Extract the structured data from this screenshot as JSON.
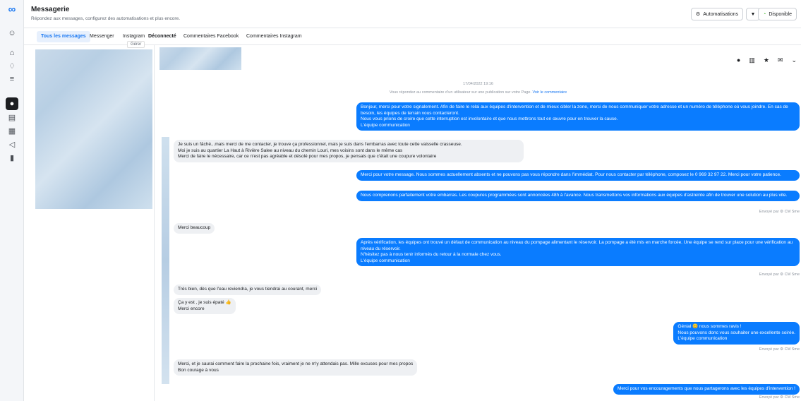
{
  "header": {
    "title": "Messagerie",
    "subtitle": "Répondez aux messages, configurez des automatisations et plus encore.",
    "automations_label": "Automatisations",
    "status_label": "Disponible"
  },
  "tabs": [
    {
      "label": "Tous les messages"
    },
    {
      "label": "Messenger"
    },
    {
      "label": "Instagram"
    },
    {
      "label": "Déconnecté"
    },
    {
      "label": "Commentaires Facebook"
    },
    {
      "label": "Commentaires Instagram"
    }
  ],
  "tooltip": "Gérer",
  "chat": {
    "timestamp": "17/04/2022 19:16",
    "notice": "Vous répondez au commentaire d’un utilisateur sur une publication sur votre Page.",
    "notice_link": "Voir le commentaire",
    "messages": [
      {
        "dir": "out",
        "text": "Bonjour, merci pour votre signalement. Afin de faire le relai aux équipes d'intervention et de mieux cibler la zone, merci de nous communiquer votre adresse et un numéro de téléphone où vous joindre. En cas de besoin, les équipes de terrain vous contacteront.\nNous vous prions de croire que cette interruption est involontaire et que nous mettrons tout en œuvre pour en trouver la cause.\nL'équipe communication"
      },
      {
        "dir": "in",
        "text": "Je suis un fâché...mais merci de me contacter, je trouve ça professionnel, mais je suis dans l'embarras avec toute cette vaisselle crasseuse.\nMoi je suis au quartier La Haut à Rivière Salee au niveau du chemin Louri, mes voisins sont dans le même cas\nMerci de faire le nécessaire, car ce n'est pas agréable et désolé pour mes propos, je pensais que c'était une coupure volontaire"
      },
      {
        "dir": "out",
        "text": "Merci pour votre message. Nous sommes actuellement absents et ne pouvons pas vous répondre dans l'immédiat. Pour nous contacter par téléphone, composez le 0 969 32 97 22. Merci pour votre patience."
      },
      {
        "dir": "out",
        "text": "Nous comprenons parfaitement votre embarras. Les coupures programmées sont annoncées 48h à l'avance. Nous transmettons vos informations aux équipes d'astreinte afin de trouver une solution au plus vite."
      },
      {
        "dir": "in",
        "text": "Merci beaucoup"
      },
      {
        "dir": "out",
        "text": "Après vérification, les équipes ont trouvé un défaut de communication au niveau du pompage alimentant le réservoir. La pompage a été mis en marche forcée. Une équipe se rend sur place pour une vérification au niveau du réservoir.\nN'hésitez pas à nous tenir informés du retour à la normale chez vous.\nL'équipe communication"
      },
      {
        "dir": "in",
        "text": "Très bien, dès que l'eau reviendra, je vous tiendrai au courant, merci"
      },
      {
        "dir": "in",
        "text": "Ça y est , je suis épaté 👍\nMerci encore"
      },
      {
        "dir": "out",
        "text": "Génial 😊 nous sommes ravis !\nNous pouvons donc vous souhaiter une excellente soirée.\nL'équipe communication"
      },
      {
        "dir": "in",
        "text": "Merci, et je saurai comment faire la prochaine fois, vraiment je ne m'y attendais pas. Mille excuses pour mes propos\nBon courage à vous"
      },
      {
        "dir": "out",
        "text": "Merci pour vos encouragements que nous partagerons avec les équipes d'intervention !"
      }
    ],
    "sent_by": "Envoyé par ⚙ CM Sme"
  }
}
